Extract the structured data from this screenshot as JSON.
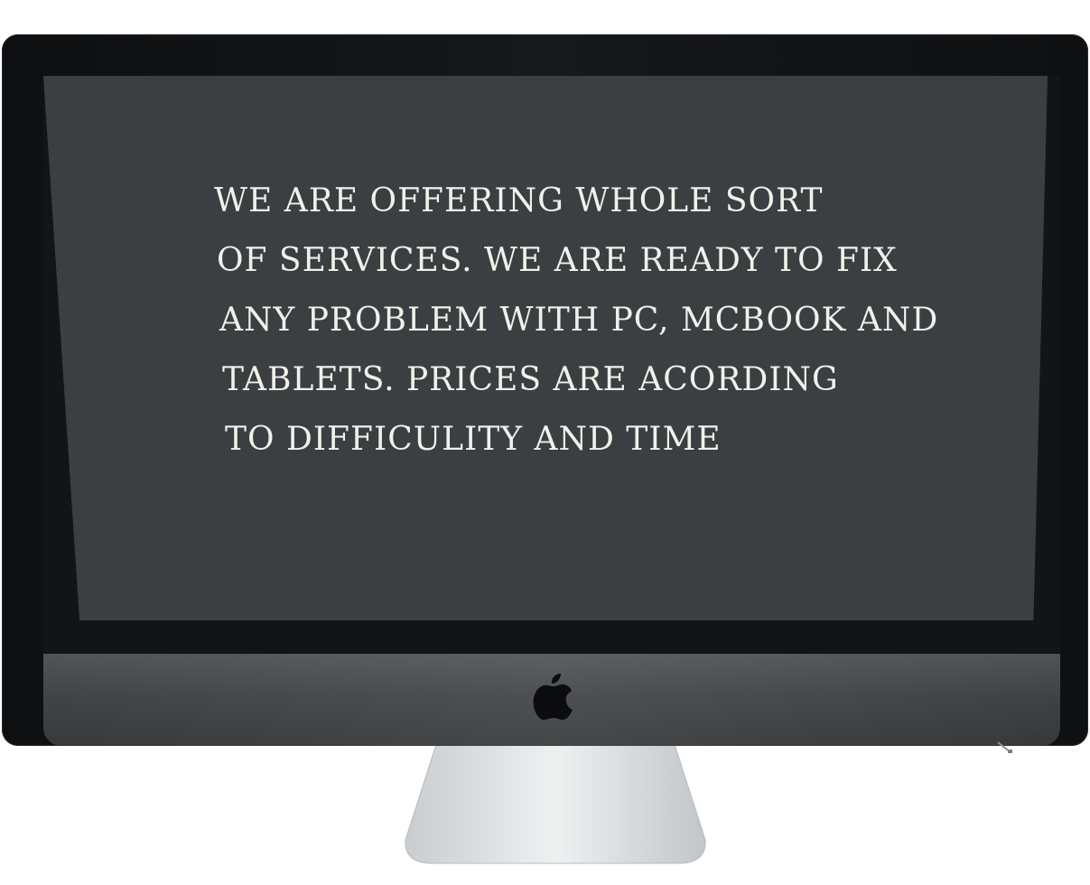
{
  "screen": {
    "lines": [
      "WE ARE OFFERING WHOLE  SORT",
      "OF SERVICES. WE ARE READY TO FIX",
      "ANY PROBLEM WITH PC, MCBOOK AND",
      "TABLETS. PRICES ARE ACORDING",
      "TO DIFFICULITY AND TIME"
    ]
  },
  "device": {
    "logo_icon": "apple-logo-icon",
    "screen_color": "#3b3f41",
    "bezel_color": "#121416",
    "text_color": "#f1f1ec"
  }
}
